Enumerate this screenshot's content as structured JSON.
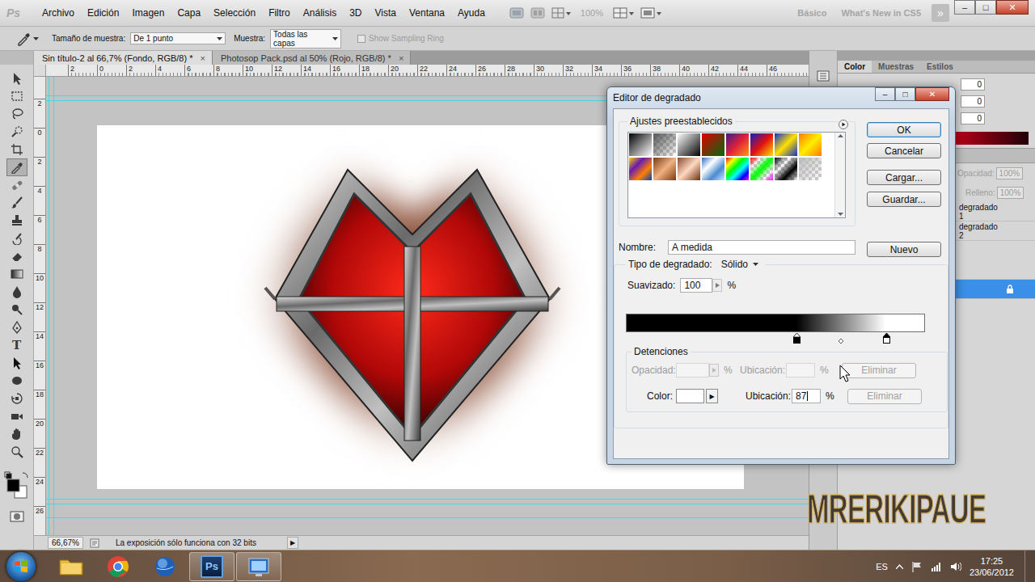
{
  "app": {
    "logo": "Ps",
    "menu": [
      "Archivo",
      "Edición",
      "Imagen",
      "Capa",
      "Selección",
      "Filtro",
      "Análisis",
      "3D",
      "Vista",
      "Ventana",
      "Ayuda"
    ],
    "zoom": "100%",
    "workspaces": [
      "Básico",
      "What's New in CS5"
    ],
    "more": "»",
    "window_buttons": [
      "–",
      "□",
      "✕"
    ]
  },
  "options_bar": {
    "sample_size_label": "Tamaño de muestra:",
    "sample_size": "De 1 punto",
    "sample_label": "Muestra:",
    "sample": "Todas las capas",
    "sampling_ring": {
      "label": "Show Sampling Ring",
      "checked": false,
      "disabled": true
    }
  },
  "tools": [
    {
      "selected": false
    },
    {
      "selected": false
    },
    {
      "selected": false
    },
    {
      "selected": false
    },
    {
      "selected": false
    },
    {
      "selected": true
    },
    {
      "selected": false
    },
    {
      "selected": false
    },
    {
      "selected": false
    },
    {
      "selected": false
    },
    {
      "selected": false
    },
    {
      "selected": false
    },
    {
      "selected": false
    },
    {
      "selected": false
    },
    {
      "selected": false
    },
    {
      "selected": false,
      "glyph": "T"
    },
    {
      "selected": false
    },
    {
      "selected": false
    },
    {
      "selected": false
    },
    {
      "selected": false
    },
    {
      "selected": false
    },
    {
      "selected": false
    }
  ],
  "doc_tabs": [
    {
      "label": "Sin título-2 al 66,7% (Fondo, RGB/8) *",
      "selected": true,
      "close": "×"
    },
    {
      "label": "Photosop Pack.psd al 50% (Rojo, RGB/8) *",
      "selected": false,
      "close": "×"
    }
  ],
  "rulers": {
    "top": [
      "2",
      "0",
      "2",
      "4",
      "6",
      "8",
      "10",
      "12",
      "14",
      "16",
      "18",
      "20",
      "22",
      "24",
      "26",
      "28",
      "30",
      "32",
      "34",
      "36",
      "38",
      "40",
      "42",
      "44",
      "46"
    ],
    "left": [
      "2",
      "0",
      "2",
      "4",
      "6",
      "8",
      "10",
      "12",
      "14",
      "16",
      "18",
      "20",
      "22",
      "24",
      "26"
    ]
  },
  "status_bar": {
    "zoom": "66,67%",
    "message": "La exposición sólo funciona con 32 bits",
    "arrow": "▶"
  },
  "color_panel": {
    "tabs": [
      {
        "label": "Color",
        "selected": true
      },
      {
        "label": "Muestras",
        "selected": false
      },
      {
        "label": "Estilos",
        "selected": false
      }
    ],
    "values": [
      "0",
      "0",
      "0"
    ]
  },
  "layers_panel": {
    "opacity_label": "Opacidad:",
    "opacity": "100%",
    "fill_label": "Relleno:",
    "fill": "100%",
    "layers": [
      {
        "name": "degradado 1",
        "selected": false,
        "locked": false
      },
      {
        "name": "degradado 2",
        "selected": false,
        "locked": false
      },
      {
        "name": "",
        "selected": true,
        "locked": true
      }
    ]
  },
  "dialog": {
    "title": "Editor de degradado",
    "window_buttons": [
      "–",
      "□",
      "✕"
    ],
    "presets_label": "Ajustes preestablecidos",
    "presets": [
      {
        "colors": [
          "#000000",
          "#ffffff"
        ],
        "transparent": false
      },
      {
        "colors": [
          "#555555",
          "#ffffff"
        ],
        "transparent": true
      },
      {
        "colors": [
          "#ffffff",
          "#000000"
        ],
        "transparent": false
      },
      {
        "colors": [
          "#e00000",
          "#006a10"
        ],
        "transparent": false
      },
      {
        "colors": [
          "#3a1a8a",
          "#e0203a",
          "#ff9a10"
        ],
        "transparent": false
      },
      {
        "colors": [
          "#1020c0",
          "#e01010",
          "#ffe000"
        ],
        "transparent": false
      },
      {
        "colors": [
          "#1030d0",
          "#ffe000",
          "#1030d0"
        ],
        "transparent": false
      },
      {
        "colors": [
          "#ff7a00",
          "#ffee00",
          "#ff7a00"
        ],
        "transparent": false
      },
      {
        "colors": [
          "#ffd000",
          "#6a1ab0",
          "#ff8000",
          "#0040c0"
        ],
        "transparent": false
      },
      {
        "colors": [
          "#7a3a10",
          "#f0b080",
          "#7a3a10"
        ],
        "transparent": false
      },
      {
        "colors": [
          "#8a4a30",
          "#ffd8c0",
          "#6a3010"
        ],
        "transparent": false
      },
      {
        "colors": [
          "#2a70c0",
          "#ffffff",
          "#4a8ad0",
          "#d0e8ff"
        ],
        "transparent": false
      },
      {
        "colors": [
          "#ff0000",
          "#ffff00",
          "#00ff00",
          "#00ffff",
          "#0000ff",
          "#ff00ff"
        ],
        "transparent": false
      },
      {
        "colors": [
          "#ff0000",
          "#ffff00",
          "#00ff00",
          "#00c0ff",
          "#ff00ff"
        ],
        "transparent": true
      },
      {
        "colors": [
          "#000000",
          "#ffffff",
          "#000000",
          "#ffffff"
        ],
        "transparent": true
      },
      {
        "colors": [
          "#bbbbbb",
          "#ffffff"
        ],
        "transparent": true
      }
    ],
    "name_label": "Nombre:",
    "name": "A medida",
    "buttons": [
      {
        "label": "OK",
        "default": true
      },
      {
        "label": "Cancelar",
        "default": false
      },
      {
        "label": "Cargar...",
        "default": false
      },
      {
        "label": "Guardar...",
        "default": false
      }
    ],
    "new_button": "Nuevo",
    "type_label": "Tipo de degradado:",
    "type": "Sólido",
    "smoothness_label": "Suavizado:",
    "smoothness": "100",
    "smoothness_unit": "%",
    "stops": [
      {
        "color": "#000000",
        "level": 0.57,
        "selected": false
      },
      {
        "color": "#ffffff",
        "level": 0.87,
        "selected": true
      }
    ],
    "midpoint": 0.72,
    "stops_group": "Detenciones",
    "opacity_row": {
      "label": "Opacidad:",
      "value": "",
      "unit": "%",
      "location_label": "Ubicación:",
      "location": "",
      "location_unit": "%",
      "delete": "Eliminar",
      "disabled": true
    },
    "color_row": {
      "label": "Color:",
      "color": "#ffffff",
      "arrow": "▶",
      "location_label": "Ubicación:",
      "location": "87",
      "location_unit": "%",
      "delete": "Eliminar",
      "disabled": false,
      "delete_disabled": true
    }
  },
  "watermark": "MRERIKIPAUE",
  "taskbar": {
    "apps": [
      {
        "open": false
      },
      {
        "open": false
      },
      {
        "open": false
      },
      {
        "open": true,
        "label": "Ps"
      },
      {
        "open": true
      }
    ],
    "language": "ES",
    "time": "17:25",
    "date": "23/06/2012"
  }
}
